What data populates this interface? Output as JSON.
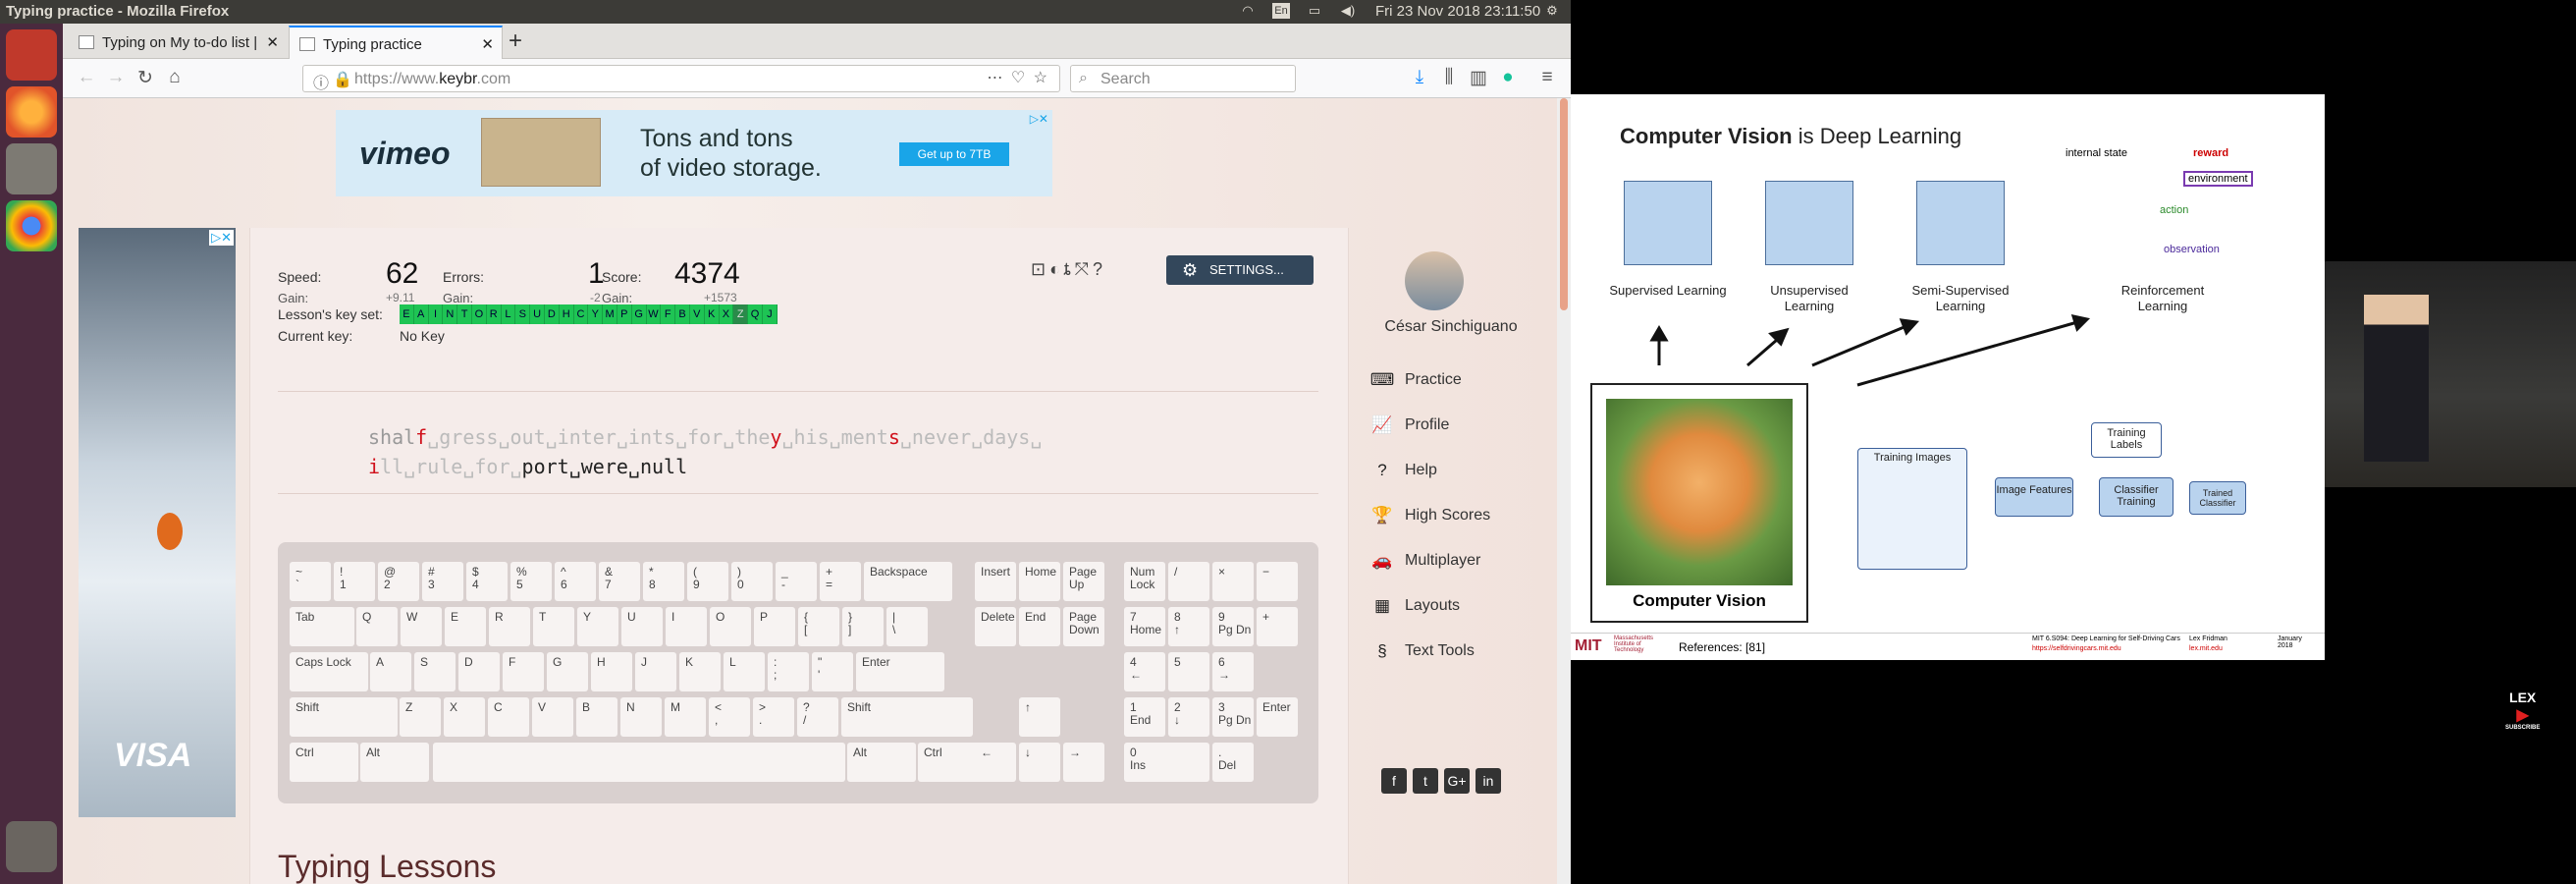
{
  "window_title": "Typing practice - Mozilla Firefox",
  "clock": "Fri 23 Nov 2018 23:11:50",
  "tray": {
    "lang": "En"
  },
  "tabs": [
    {
      "label": "Typing on My to-do list |"
    },
    {
      "label": "Typing practice"
    }
  ],
  "new_tab_label": "+",
  "url": {
    "prefix": "https://www.",
    "domain": "keybr",
    "suffix": ".com"
  },
  "search_placeholder": "Search",
  "ad_top": {
    "brand": "vimeo",
    "line1": "Tons and tons",
    "line2": "of video storage.",
    "cta": "Get up to 7TB"
  },
  "ad_side": {
    "brand": "VISA"
  },
  "stats": {
    "speed_label": "Speed:",
    "speed": "62",
    "speed_gain_label": "Gain:",
    "speed_gain": "+9.11",
    "errors_label": "Errors:",
    "errors": "1",
    "errors_gain_label": "Gain:",
    "errors_gain": "-2",
    "score_label": "Score:",
    "score": "4374",
    "score_gain_label": "Gain:",
    "score_gain": "+1573"
  },
  "keyset_label": "Lesson's key set:",
  "keyset": [
    "E",
    "A",
    "I",
    "N",
    "T",
    "O",
    "R",
    "L",
    "S",
    "U",
    "D",
    "H",
    "C",
    "Y",
    "M",
    "P",
    "G",
    "W",
    "F",
    "B",
    "V",
    "K",
    "X",
    "Z",
    "Q",
    "J"
  ],
  "current_key_label": "Current key:",
  "current_key": "No Key",
  "settings_label": "SETTINGS...",
  "practice": {
    "line1_typed1": "shal",
    "line1_err1": "f",
    "line1_rest1": "␣gress␣out␣inter␣ints␣for␣the",
    "line1_err2": "y",
    "line1_rest2": "␣his␣ment",
    "line1_err3": "s",
    "line1_rest3": "␣never␣days␣",
    "line2_err": "i",
    "line2_rest": "ll␣rule␣for␣",
    "line2_typed": "port␣were␣null"
  },
  "keyboard": {
    "row1": [
      [
        "~",
        "`"
      ],
      [
        "!",
        "1"
      ],
      [
        "@",
        "2"
      ],
      [
        "#",
        "3"
      ],
      [
        "$",
        "4"
      ],
      [
        "%",
        "5"
      ],
      [
        "^",
        "6"
      ],
      [
        "&",
        "7"
      ],
      [
        "*",
        "8"
      ],
      [
        "(",
        "9"
      ],
      [
        ")",
        "0"
      ],
      [
        "_",
        "-"
      ],
      [
        "+",
        "="
      ]
    ],
    "backspace": "Backspace",
    "tab": "Tab",
    "row2": [
      "Q",
      "W",
      "E",
      "R",
      "T",
      "Y",
      "U",
      "I",
      "O",
      "P"
    ],
    "row2_extra": [
      [
        "{",
        "["
      ],
      [
        "}",
        "]"
      ],
      [
        "|",
        "\\"
      ]
    ],
    "caps": "Caps Lock",
    "row3": [
      "A",
      "S",
      "D",
      "F",
      "G",
      "H",
      "J",
      "K",
      "L"
    ],
    "row3_extra": [
      [
        ":",
        ";"
      ],
      [
        "\"",
        "'"
      ]
    ],
    "enter": "Enter",
    "shift": "Shift",
    "row4": [
      "Z",
      "X",
      "C",
      "V",
      "B",
      "N",
      "M"
    ],
    "row4_extra": [
      [
        "<",
        ","
      ],
      [
        ">",
        "."
      ],
      [
        "?",
        "/"
      ]
    ],
    "ctrl": "Ctrl",
    "alt": "Alt",
    "nav": [
      "Insert",
      "Home",
      "Page Up",
      "Delete",
      "End",
      "Page Down"
    ],
    "arrows": [
      "↑",
      "←",
      "↓",
      "→"
    ],
    "numpad": [
      [
        "Num Lock",
        ""
      ],
      [
        "/",
        ""
      ],
      [
        "×",
        ""
      ],
      [
        "−",
        ""
      ],
      [
        "7",
        "Home"
      ],
      [
        "8",
        "↑"
      ],
      [
        "9",
        "Pg Dn"
      ],
      [
        "+",
        ""
      ],
      [
        "4",
        "←"
      ],
      [
        "5",
        ""
      ],
      [
        "6",
        "→"
      ],
      [
        "1",
        "End"
      ],
      [
        "2",
        "↓"
      ],
      [
        "3",
        "Pg Dn"
      ],
      [
        "Enter",
        ""
      ],
      [
        "0",
        "Ins"
      ],
      [
        ".",
        "Del"
      ]
    ]
  },
  "typing_lessons": "Typing Lessons",
  "user_name": "César Sinchiguano",
  "sidebar": [
    {
      "label": "Practice",
      "icon": "keyboard-icon"
    },
    {
      "label": "Profile",
      "icon": "chart-icon"
    },
    {
      "label": "Help",
      "icon": "help-icon"
    },
    {
      "label": "High Scores",
      "icon": "trophy-icon"
    },
    {
      "label": "Multiplayer",
      "icon": "car-icon"
    },
    {
      "label": "Layouts",
      "icon": "layout-icon"
    },
    {
      "label": "Text Tools",
      "icon": "section-icon"
    }
  ],
  "slide": {
    "title_bold": "Computer Vision",
    "title_rest": " is Deep Learning",
    "sup": "Supervised Learning",
    "unsup": "Unsupervised Learning",
    "semi": "Semi-Supervised Learning",
    "rl": "Reinforcement Learning",
    "rl_state": "internal state",
    "rl_reward": "reward",
    "rl_env": "environment",
    "rl_action": "action",
    "rl_obs": "observation",
    "cv_caption": "Computer Vision",
    "training_images": "Training Images",
    "image_features": "Image Features",
    "training_labels": "Training Labels",
    "classifier_training": "Classifier Training",
    "trained_classifier": "Trained Classifier",
    "mit": "MIT",
    "mit_sub": "Massachusetts Institute of Technology",
    "refs": "References: [81]",
    "course": "MIT 6.S094: Deep Learning for Self-Driving Cars",
    "course_url": "https://selfdrivingcars.mit.edu",
    "author": "Lex Fridman",
    "author_mail": "lex.mit.edu",
    "date": "January 2018"
  },
  "channel": {
    "name": "LEX",
    "sub": "SUBSCRIBE"
  },
  "colors": {
    "accent": "#33475b",
    "key_green": "#1ec454",
    "error": "#d0101b"
  }
}
